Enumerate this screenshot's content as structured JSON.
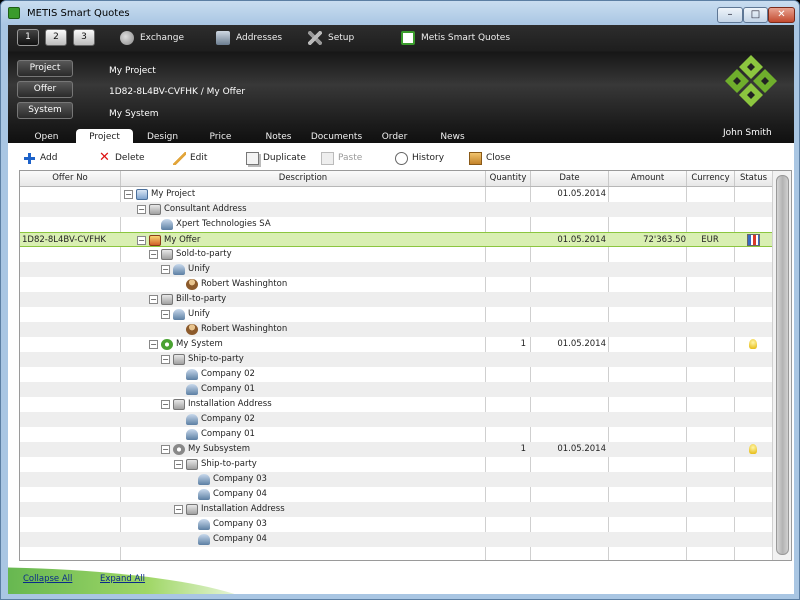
{
  "window": {
    "title": "METIS Smart Quotes"
  },
  "topbar": {
    "numbers": [
      "1",
      "2",
      "3"
    ],
    "exchange": "Exchange",
    "addresses": "Addresses",
    "setup": "Setup",
    "metis": "Metis Smart Quotes"
  },
  "levels": [
    {
      "label": "Project",
      "value": "My Project"
    },
    {
      "label": "Offer",
      "value": "1D82-8L4BV-CVFHK / My Offer"
    },
    {
      "label": "System",
      "value": "My System"
    }
  ],
  "user": "John Smith",
  "tabs": [
    "Open",
    "Project",
    "Design",
    "Price",
    "Notes",
    "Documents",
    "Order",
    "News"
  ],
  "active_tab": "Project",
  "toolbar": {
    "add": "Add",
    "delete": "Delete",
    "edit": "Edit",
    "duplicate": "Duplicate",
    "paste": "Paste",
    "history": "History",
    "close": "Close"
  },
  "columns": {
    "offer": "Offer No",
    "description": "Description",
    "quantity": "Quantity",
    "date": "Date",
    "amount": "Amount",
    "currency": "Currency",
    "status": "Status"
  },
  "rows": [
    {
      "offer": "",
      "exp": "⊟",
      "icon": "project",
      "desc": "My Project",
      "qty": "",
      "date": "01.05.2014",
      "amount": "",
      "currency": ""
    },
    {
      "offer": "",
      "exp": "⊟",
      "icon": "addr",
      "desc": "Consultant Address",
      "qty": "",
      "date": "",
      "amount": "",
      "currency": ""
    },
    {
      "offer": "",
      "exp": "",
      "icon": "company",
      "desc": "Xpert Technologies SA",
      "qty": "",
      "date": "",
      "amount": "",
      "currency": ""
    },
    {
      "offer": "1D82-8L4BV-CVFHK",
      "exp": "⊟",
      "icon": "offer",
      "desc": "My Offer",
      "qty": "",
      "date": "01.05.2014",
      "amount": "72'363.50",
      "currency": "EUR"
    },
    {
      "offer": "",
      "exp": "⊟",
      "icon": "addr",
      "desc": "Sold-to-party",
      "qty": "",
      "date": "",
      "amount": "",
      "currency": ""
    },
    {
      "offer": "",
      "exp": "⊟",
      "icon": "company",
      "desc": "Unify",
      "qty": "",
      "date": "",
      "amount": "",
      "currency": ""
    },
    {
      "offer": "",
      "exp": "",
      "icon": "person",
      "desc": "Robert Washinghton",
      "qty": "",
      "date": "",
      "amount": "",
      "currency": ""
    },
    {
      "offer": "",
      "exp": "⊟",
      "icon": "addr",
      "desc": "Bill-to-party",
      "qty": "",
      "date": "",
      "amount": "",
      "currency": ""
    },
    {
      "offer": "",
      "exp": "⊟",
      "icon": "company",
      "desc": "Unify",
      "qty": "",
      "date": "",
      "amount": "",
      "currency": ""
    },
    {
      "offer": "",
      "exp": "",
      "icon": "person",
      "desc": "Robert Washinghton",
      "qty": "",
      "date": "",
      "amount": "",
      "currency": ""
    },
    {
      "offer": "",
      "exp": "⊟",
      "icon": "system",
      "desc": "My System",
      "qty": "1",
      "date": "01.05.2014",
      "amount": "",
      "currency": ""
    },
    {
      "offer": "",
      "exp": "⊟",
      "icon": "addr",
      "desc": "Ship-to-party",
      "qty": "",
      "date": "",
      "amount": "",
      "currency": ""
    },
    {
      "offer": "",
      "exp": "",
      "icon": "company",
      "desc": "Company 02",
      "qty": "",
      "date": "",
      "amount": "",
      "currency": ""
    },
    {
      "offer": "",
      "exp": "",
      "icon": "company",
      "desc": "Company 01",
      "qty": "",
      "date": "",
      "amount": "",
      "currency": ""
    },
    {
      "offer": "",
      "exp": "⊟",
      "icon": "addr",
      "desc": "Installation Address",
      "qty": "",
      "date": "",
      "amount": "",
      "currency": ""
    },
    {
      "offer": "",
      "exp": "",
      "icon": "company",
      "desc": "Company 02",
      "qty": "",
      "date": "",
      "amount": "",
      "currency": ""
    },
    {
      "offer": "",
      "exp": "",
      "icon": "company",
      "desc": "Company 01",
      "qty": "",
      "date": "",
      "amount": "",
      "currency": ""
    },
    {
      "offer": "",
      "exp": "⊟",
      "icon": "subsys",
      "desc": "My Subsystem",
      "qty": "1",
      "date": "01.05.2014",
      "amount": "",
      "currency": ""
    },
    {
      "offer": "",
      "exp": "⊟",
      "icon": "addr",
      "desc": "Ship-to-party",
      "qty": "",
      "date": "",
      "amount": "",
      "currency": ""
    },
    {
      "offer": "",
      "exp": "",
      "icon": "company",
      "desc": "Company 03",
      "qty": "",
      "date": "",
      "amount": "",
      "currency": ""
    },
    {
      "offer": "",
      "exp": "",
      "icon": "company",
      "desc": "Company 04",
      "qty": "",
      "date": "",
      "amount": "",
      "currency": ""
    },
    {
      "offer": "",
      "exp": "⊟",
      "icon": "addr",
      "desc": "Installation Address",
      "qty": "",
      "date": "",
      "amount": "",
      "currency": ""
    },
    {
      "offer": "",
      "exp": "",
      "icon": "company",
      "desc": "Company 03",
      "qty": "",
      "date": "",
      "amount": "",
      "currency": ""
    },
    {
      "offer": "",
      "exp": "",
      "icon": "company",
      "desc": "Company 04",
      "qty": "",
      "date": "",
      "amount": "",
      "currency": ""
    }
  ],
  "footer": {
    "collapse": "Collapse All",
    "expand": "Expand All"
  }
}
